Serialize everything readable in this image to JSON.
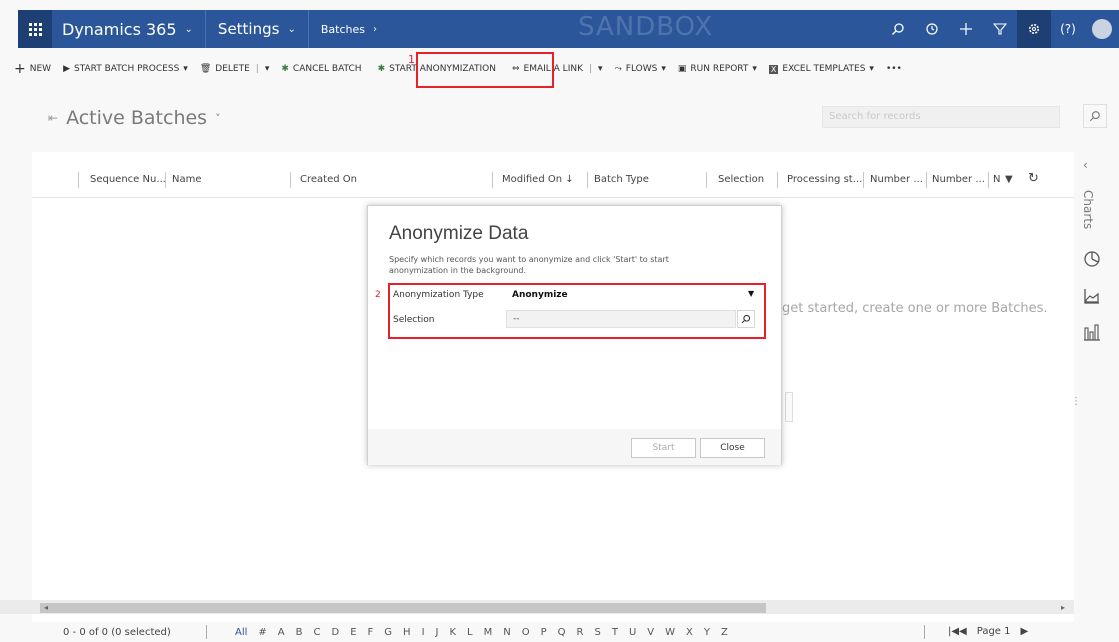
{
  "nav": {
    "app_name": "Dynamics 365",
    "area": "Settings",
    "breadcrumb": "Batches",
    "environment_watermark": "SANDBOX",
    "colors": {
      "nav_bg": "#2b579a",
      "highlight": "#e8202a"
    }
  },
  "commands": {
    "new": "NEW",
    "start_batch": "START BATCH PROCESS",
    "delete": "DELETE",
    "cancel_batch": "CANCEL BATCH",
    "start_anonymization": "START ANONYMIZATION",
    "email_link": "EMAIL A LINK",
    "flows": "FLOWS",
    "run_report": "RUN REPORT",
    "excel_templates": "EXCEL TEMPLATES",
    "more": "•••",
    "annotation_1": "1"
  },
  "view": {
    "title": "Active Batches",
    "search_placeholder": "Search for records"
  },
  "grid": {
    "columns": [
      "Sequence Nu...",
      "Name",
      "Created On",
      "Modified On",
      "Batch Type",
      "Selection",
      "Processing st...",
      "Number ...",
      "Number ...",
      "N"
    ],
    "empty_message": "get started, create one or more Batches.",
    "record_count": "0 - 0 of 0 (0 selected)",
    "letters": [
      "All",
      "#",
      "A",
      "B",
      "C",
      "D",
      "E",
      "F",
      "G",
      "H",
      "I",
      "J",
      "K",
      "L",
      "M",
      "N",
      "O",
      "P",
      "Q",
      "R",
      "S",
      "T",
      "U",
      "V",
      "W",
      "X",
      "Y",
      "Z"
    ],
    "page": "Page 1"
  },
  "rail": {
    "charts_label": "Charts"
  },
  "dialog": {
    "title": "Anonymize Data",
    "description": "Specify which records you want to anonymize and click 'Start' to start anonymization in the background.",
    "annotation_2": "2",
    "type_label": "Anonymization Type",
    "type_value": "Anonymize",
    "selection_label": "Selection",
    "selection_value": "--",
    "start_label": "Start",
    "close_label": "Close"
  }
}
